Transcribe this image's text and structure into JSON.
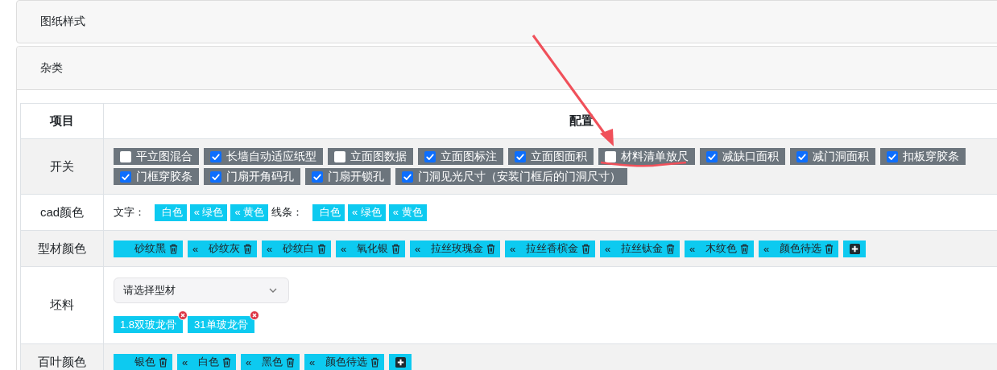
{
  "sections": [
    {
      "title": "图纸样式"
    }
  ],
  "misc": {
    "title": "杂类",
    "columns": [
      "项目",
      "配置"
    ],
    "rows": [
      {
        "kind": "checks",
        "label": "开关",
        "options": [
          {
            "label": "平立图混合",
            "checked": false
          },
          {
            "label": "长墙自动适应纸型",
            "checked": true
          },
          {
            "label": "立面图数据",
            "checked": false
          },
          {
            "label": "立面图标注",
            "checked": true
          },
          {
            "label": "立面图面积",
            "checked": true
          },
          {
            "label": "材料清单放尺",
            "checked": false
          },
          {
            "label": "减缺口面积",
            "checked": true
          },
          {
            "label": "减门洞面积",
            "checked": true
          },
          {
            "label": "扣板穿胶条",
            "checked": true
          },
          {
            "label": "门框穿胶条",
            "checked": true
          },
          {
            "label": "门扇开角码孔",
            "checked": true
          },
          {
            "label": "门扇开锁孔",
            "checked": true
          },
          {
            "label": "门洞见光尺寸（安装门框后的门洞尺寸）",
            "checked": true
          }
        ]
      },
      {
        "kind": "cad",
        "label": "cad颜色",
        "groups": [
          {
            "label": "文字：",
            "tags": [
              {
                "text": "白色"
              },
              {
                "prefix": "«",
                "text": "绿色"
              },
              {
                "prefix": "«",
                "text": "黄色"
              }
            ]
          },
          {
            "label": "线条：",
            "tags": [
              {
                "text": "白色"
              },
              {
                "prefix": "«",
                "text": "绿色"
              },
              {
                "prefix": "«",
                "text": "黄色"
              }
            ]
          }
        ]
      },
      {
        "kind": "colors",
        "label": "型材颜色",
        "items": [
          {
            "text": "砂纹黑"
          },
          {
            "prefix": "«",
            "text": "砂纹灰"
          },
          {
            "prefix": "«",
            "text": "砂纹白"
          },
          {
            "prefix": "«",
            "text": "氧化银"
          },
          {
            "prefix": "«",
            "text": "拉丝玫瑰金"
          },
          {
            "prefix": "«",
            "text": "拉丝香槟金"
          },
          {
            "prefix": "«",
            "text": "拉丝钛金"
          },
          {
            "prefix": "«",
            "text": "木纹色"
          },
          {
            "prefix": "«",
            "text": "颜色待选"
          }
        ]
      },
      {
        "kind": "material",
        "label": "坯料",
        "placeholder": "请选择型材",
        "tags": [
          {
            "text": "1.8双玻龙骨"
          },
          {
            "text": "31单玻龙骨"
          }
        ]
      },
      {
        "kind": "colors",
        "label": "百叶颜色",
        "items": [
          {
            "text": "银色"
          },
          {
            "prefix": "«",
            "text": "白色"
          },
          {
            "prefix": "«",
            "text": "黑色"
          },
          {
            "prefix": "«",
            "text": "颜色待选"
          }
        ]
      }
    ]
  }
}
